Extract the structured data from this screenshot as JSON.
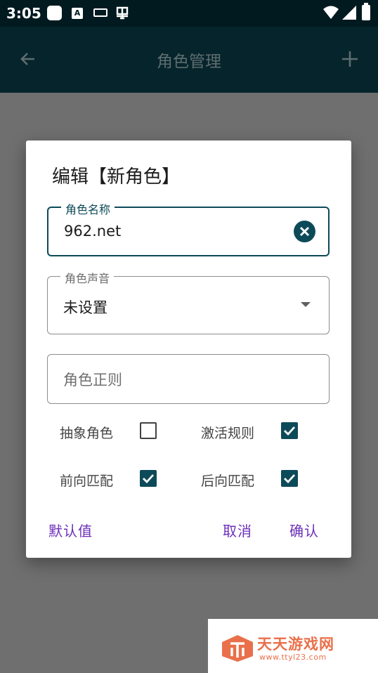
{
  "status_bar": {
    "time": "3:05",
    "icons": [
      "square-notification-icon",
      "a-keyboard-icon",
      "keyboard-icon",
      "bug-icon",
      "wifi-icon",
      "signal-icon",
      "battery-icon"
    ]
  },
  "app_bar": {
    "title": "角色管理",
    "back_icon": "arrow-left-icon",
    "add_icon": "plus-icon"
  },
  "dialog": {
    "title": "编辑【新角色】",
    "name_field": {
      "label": "角色名称",
      "value": "962.net"
    },
    "voice_field": {
      "label": "角色声音",
      "value": "未设置"
    },
    "regex_field": {
      "placeholder": "角色正则"
    },
    "checkboxes": [
      {
        "label": "抽象角色",
        "checked": false
      },
      {
        "label": "激活规则",
        "checked": true
      },
      {
        "label": "前向匹配",
        "checked": true
      },
      {
        "label": "后向匹配",
        "checked": true
      }
    ],
    "actions": {
      "default": "默认值",
      "cancel": "取消",
      "confirm": "确认"
    }
  },
  "watermark": {
    "name": "天天游戏网",
    "url": "www.ttyl23.com"
  },
  "colors": {
    "status_bar": "#001a20",
    "app_bar": "#06242b",
    "accent": "#0d4a59",
    "action_text": "#6b2fb8",
    "scrim": "#6f6f6f",
    "watermark": "#e9704a"
  }
}
